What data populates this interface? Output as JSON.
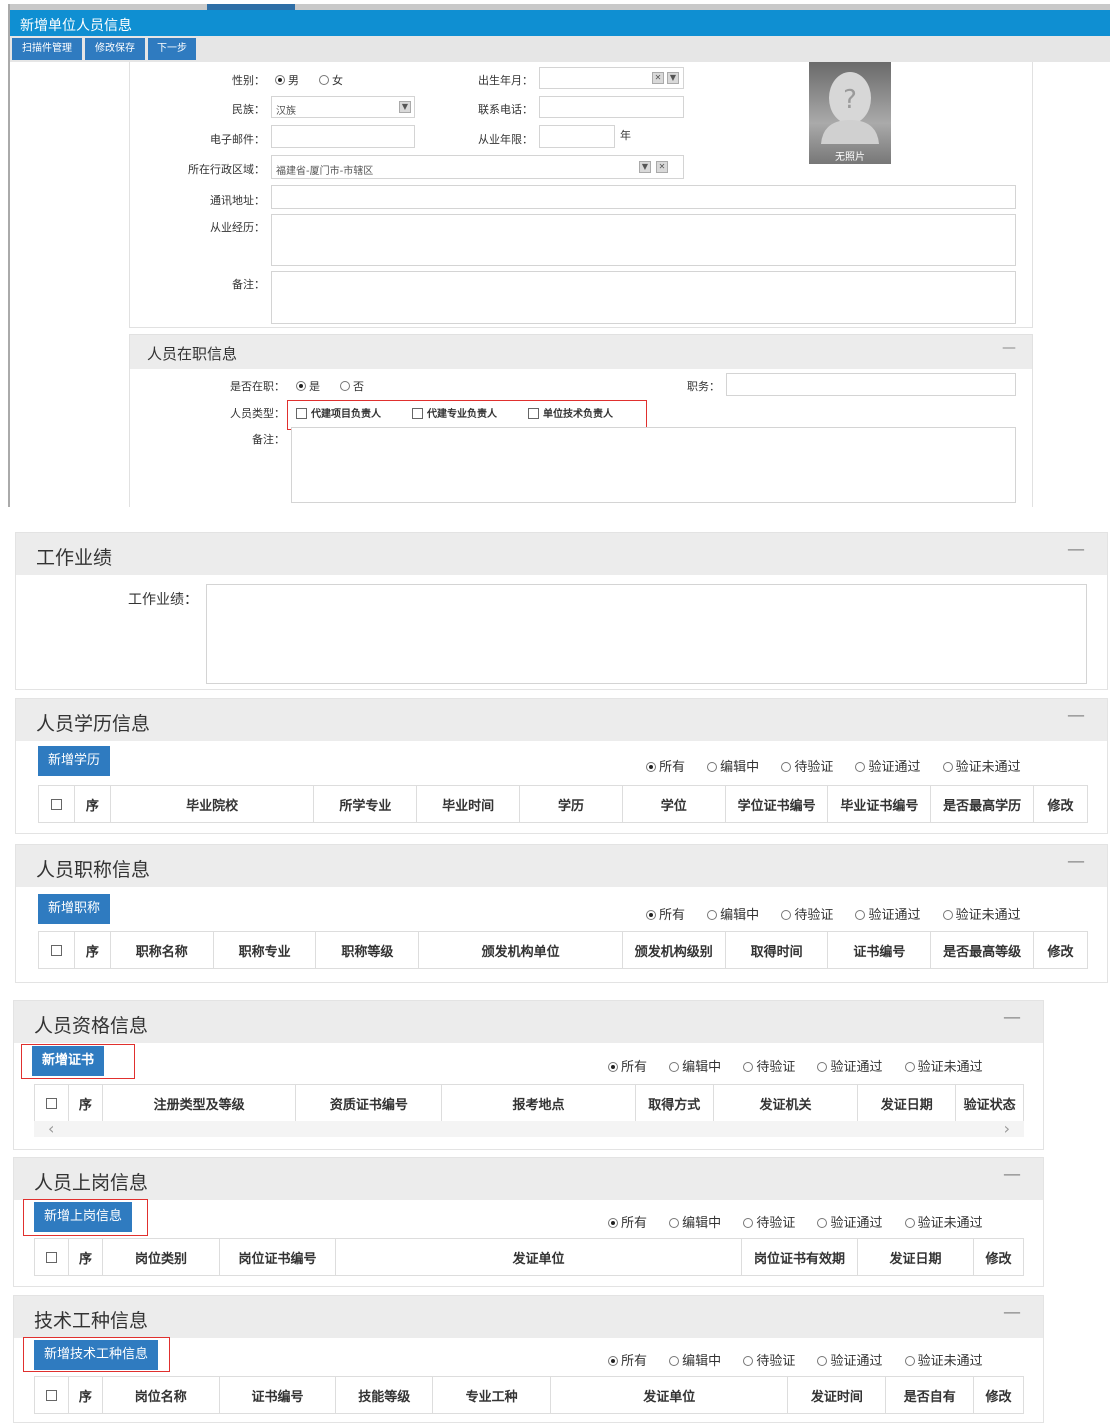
{
  "top": {
    "title": "新增单位人员信息",
    "toolbar": [
      "扫描件管理",
      "修改保存",
      "下一步"
    ]
  },
  "basic": {
    "gender_label": "性别：",
    "gender_male": "男",
    "gender_female": "女",
    "birth_label": "出生年月：",
    "ethnic_label": "民族：",
    "ethnic_value": "汉族",
    "phone_label": "联系电话：",
    "email_label": "电子邮件：",
    "years_label": "从业年限：",
    "years_unit": "年",
    "region_label": "所在行政区域：",
    "region_value": "福建省-厦门市-市辖区",
    "address_label": "通讯地址：",
    "history_label": "从业经历：",
    "remark_label": "备注：",
    "photo_text": "无照片"
  },
  "employ": {
    "title": "人员在职信息",
    "collapse": "—",
    "active_label": "是否在职：",
    "active_yes": "是",
    "active_no": "否",
    "position_label": "职务：",
    "type_label": "人员类型：",
    "types": [
      "代建项目负责人",
      "代建专业负责人",
      "单位技术负责人"
    ],
    "remark_label": "备注："
  },
  "filters": [
    "所有",
    "编辑中",
    "待验证",
    "验证通过",
    "验证未通过"
  ],
  "perf": {
    "title": "工作业绩",
    "collapse": "—",
    "label": "工作业绩："
  },
  "edu": {
    "title": "人员学历信息",
    "collapse": "—",
    "button": "新增学历",
    "columns": [
      "序",
      "毕业院校",
      "所学专业",
      "毕业时间",
      "学历",
      "学位",
      "学位证书编号",
      "毕业证书编号",
      "是否最高学历",
      "修改"
    ]
  },
  "title_info": {
    "title": "人员职称信息",
    "collapse": "—",
    "button": "新增职称",
    "columns": [
      "序",
      "职称名称",
      "职称专业",
      "职称等级",
      "颁发机构单位",
      "颁发机构级别",
      "取得时间",
      "证书编号",
      "是否最高等级",
      "修改"
    ]
  },
  "qual": {
    "title": "人员资格信息",
    "collapse": "—",
    "button": "新增证书",
    "columns": [
      "序",
      "注册类型及等级",
      "资质证书编号",
      "报考地点",
      "取得方式",
      "发证机关",
      "发证日期",
      "验证状态"
    ],
    "scroll_left": "‹",
    "scroll_right": "›"
  },
  "post": {
    "title": "人员上岗信息",
    "collapse": "—",
    "button": "新增上岗信息",
    "columns": [
      "序",
      "岗位类别",
      "岗位证书编号",
      "发证单位",
      "岗位证书有效期",
      "发证日期",
      "修改"
    ]
  },
  "tech": {
    "title": "技术工种信息",
    "collapse": "—",
    "button": "新增技术工种信息",
    "columns": [
      "序",
      "岗位名称",
      "证书编号",
      "技能等级",
      "专业工种",
      "发证单位",
      "发证时间",
      "是否自有",
      "修改"
    ]
  }
}
